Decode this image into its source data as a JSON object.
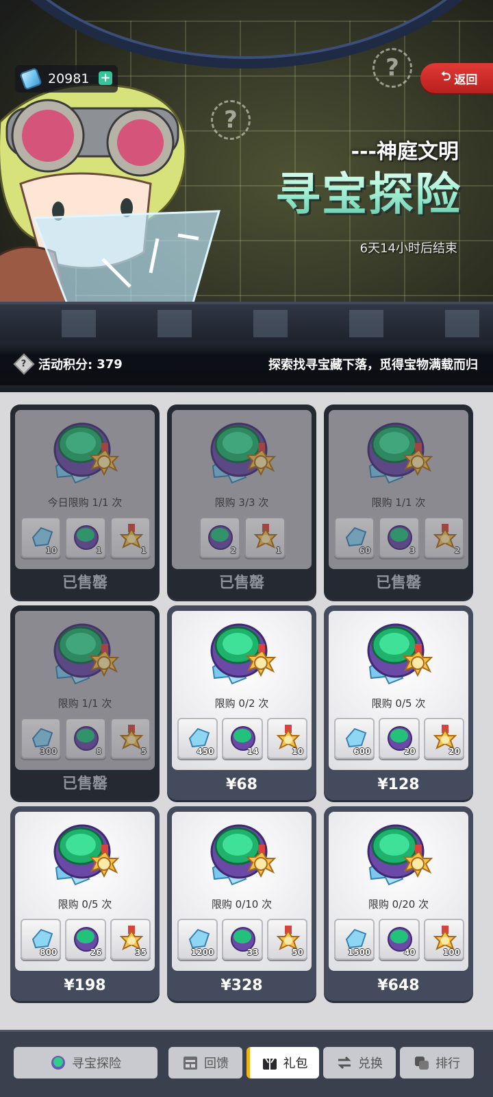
{
  "currency": {
    "amount": "20981",
    "plus": "+"
  },
  "header": {
    "back_label": "返回",
    "subtitle": "---神庭文明",
    "title": "寻宝探险",
    "end_time": "6天14小时后结束"
  },
  "score": {
    "label": "活动积分:",
    "value": "379",
    "slogan": "探索找寻宝藏下落，觅得宝物满载而归"
  },
  "packs": [
    {
      "limit": "今日限购 1/1 次",
      "items": [
        "10",
        "1",
        "1"
      ],
      "price": "已售罄",
      "sold_out": true
    },
    {
      "limit": "限购 3/3 次",
      "items": [
        "2",
        "1"
      ],
      "price": "已售罄",
      "sold_out": true
    },
    {
      "limit": "限购 1/1 次",
      "items": [
        "60",
        "3",
        "2"
      ],
      "price": "已售罄",
      "sold_out": true
    },
    {
      "limit": "限购 1/1 次",
      "items": [
        "300",
        "8",
        "5"
      ],
      "price": "已售罄",
      "sold_out": true
    },
    {
      "limit": "限购 0/2 次",
      "items": [
        "450",
        "14",
        "10"
      ],
      "price": "¥68",
      "sold_out": false
    },
    {
      "limit": "限购 0/5 次",
      "items": [
        "600",
        "20",
        "20"
      ],
      "price": "¥128",
      "sold_out": false
    },
    {
      "limit": "限购 0/5 次",
      "items": [
        "800",
        "26",
        "35"
      ],
      "price": "¥198",
      "sold_out": false
    },
    {
      "limit": "限购 0/10 次",
      "items": [
        "1200",
        "33",
        "50"
      ],
      "price": "¥328",
      "sold_out": false
    },
    {
      "limit": "限购 0/20 次",
      "items": [
        "1500",
        "40",
        "100"
      ],
      "price": "¥648",
      "sold_out": false
    }
  ],
  "nav": {
    "tabs": [
      {
        "label": "寻宝探险",
        "icon": "globe-icon"
      },
      {
        "label": "回馈",
        "icon": "calendar-icon"
      },
      {
        "label": "礼包",
        "icon": "gift-box-icon",
        "active": true
      },
      {
        "label": "兑换",
        "icon": "exchange-icon"
      },
      {
        "label": "排行",
        "icon": "ranking-icon"
      }
    ]
  },
  "colors": {
    "accent": "#f0b318",
    "back_button": "#d32f2c",
    "title_gradient": "#9ff0d7"
  }
}
